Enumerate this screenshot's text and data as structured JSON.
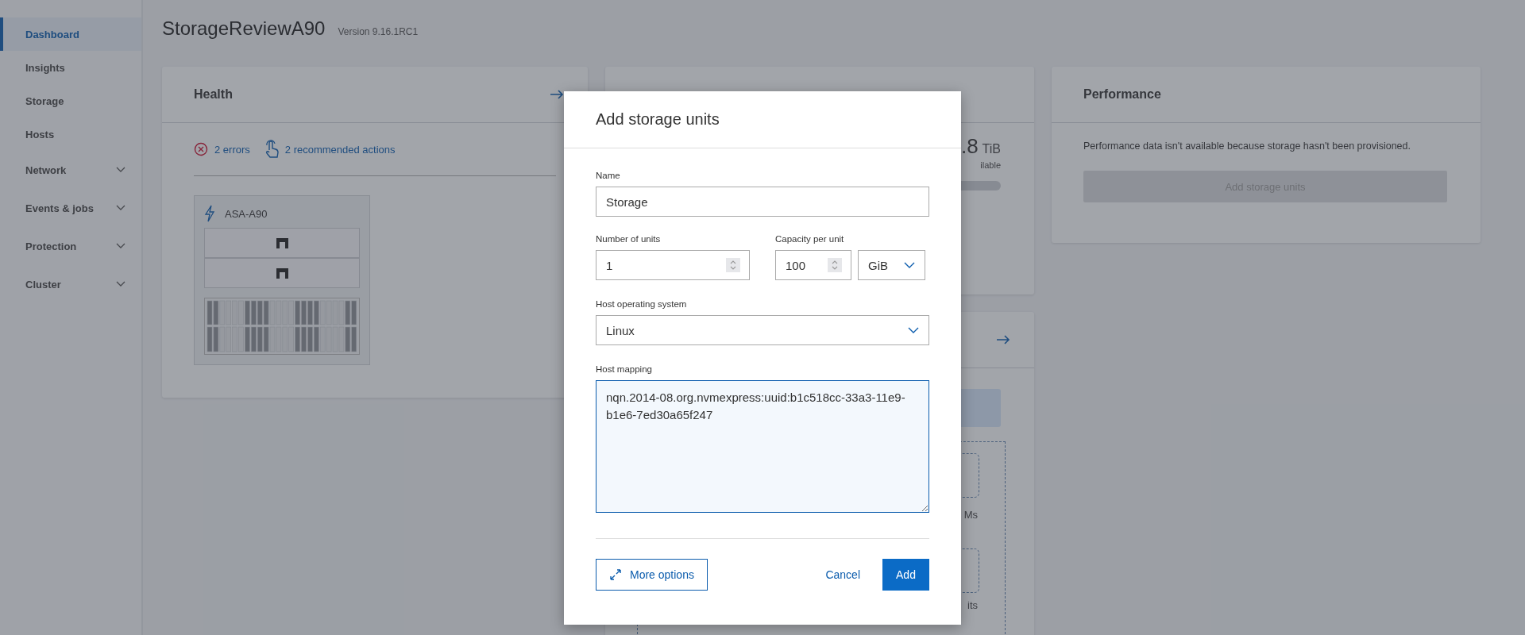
{
  "sidebar": {
    "items": [
      {
        "label": "Dashboard",
        "selected": true,
        "expandable": false
      },
      {
        "label": "Insights",
        "selected": false,
        "expandable": false
      },
      {
        "label": "Storage",
        "selected": false,
        "expandable": false
      },
      {
        "label": "Hosts",
        "selected": false,
        "expandable": false
      },
      {
        "label": "Network",
        "selected": false,
        "expandable": true
      },
      {
        "label": "Events & jobs",
        "selected": false,
        "expandable": true
      },
      {
        "label": "Protection",
        "selected": false,
        "expandable": true
      },
      {
        "label": "Cluster",
        "selected": false,
        "expandable": true
      }
    ]
  },
  "header": {
    "title": "StorageReviewA90",
    "version": "Version 9.16.1RC1"
  },
  "health_card": {
    "title": "Health",
    "errors": "2 errors",
    "actions": "2 recommended actions",
    "system": {
      "name": "ASA-A90"
    }
  },
  "capacity_card": {
    "value_fragment": ".8",
    "unit": "TiB",
    "caption_fragment": "ilable"
  },
  "hosts_card": {
    "fragments": [
      "Ms",
      "its"
    ]
  },
  "performance_card": {
    "title": "Performance",
    "message": "Performance data isn't available because storage hasn't been provisioned.",
    "button": {
      "label": "Add storage units",
      "disabled": true
    }
  },
  "dialog": {
    "title": "Add storage units",
    "name": {
      "label": "Name",
      "value": "Storage"
    },
    "units": {
      "label": "Number of units",
      "value": "1"
    },
    "capacity": {
      "label": "Capacity per unit",
      "value": "100",
      "unit": "GiB"
    },
    "os": {
      "label": "Host operating system",
      "value": "Linux"
    },
    "mapping": {
      "label": "Host mapping",
      "value": "nqn.2014-08.org.nvmexpress:uuid:b1c518cc-33a3-11e9-b1e6-7ed30a65f247"
    },
    "more_options": "More options",
    "cancel": "Cancel",
    "add": "Add"
  }
}
